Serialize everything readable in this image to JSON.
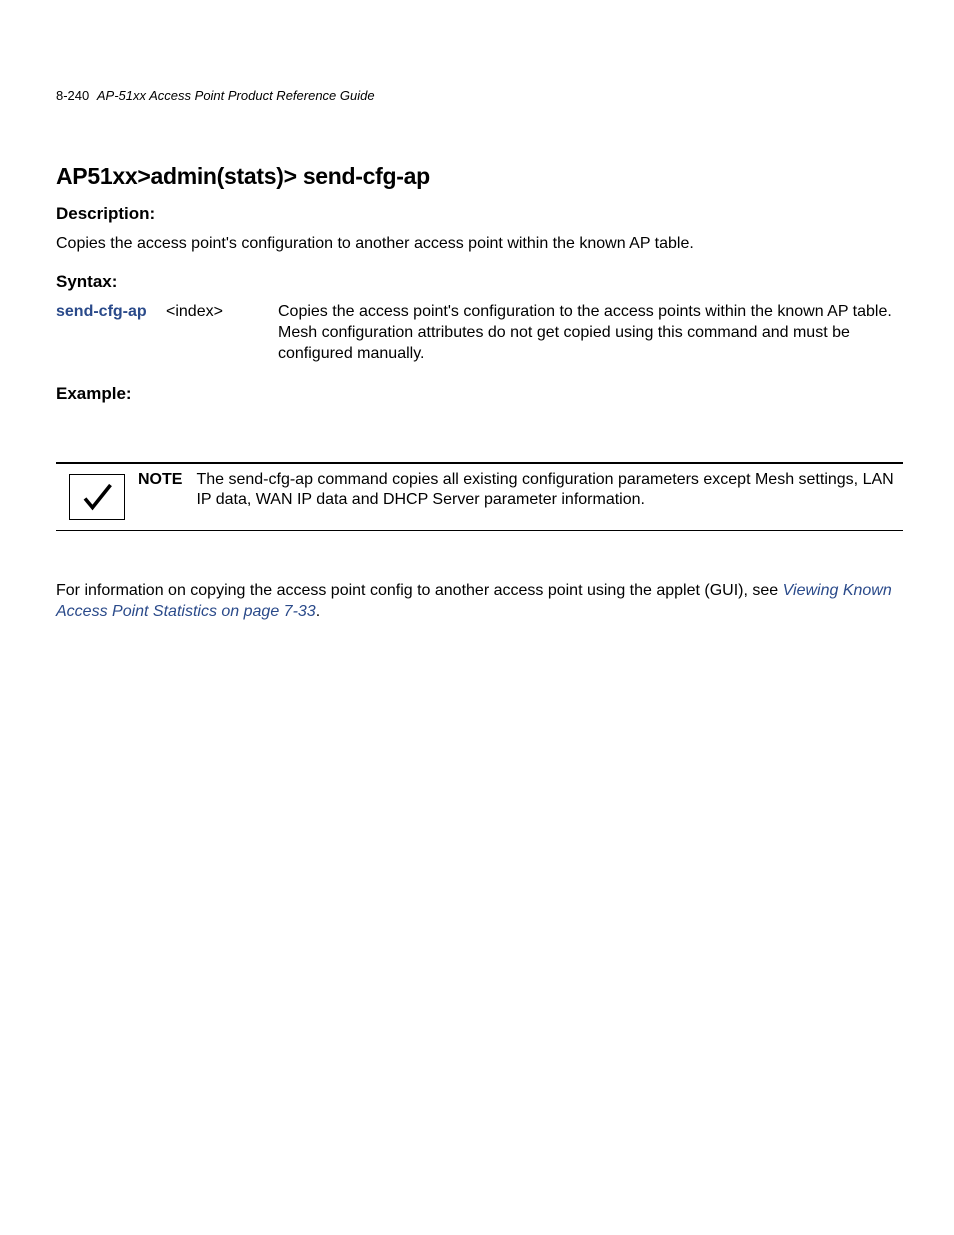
{
  "header": {
    "page_number": "8-240",
    "doc_title": "AP-51xx Access Point Product Reference Guide"
  },
  "title": "AP51xx>admin(stats)> send-cfg-ap",
  "sections": {
    "description": {
      "heading": "Description:",
      "body": "Copies the access point's configuration to another access point within the known AP table."
    },
    "syntax": {
      "heading": "Syntax:",
      "row": {
        "command": "send-cfg-ap",
        "arg": "<index>",
        "desc": "Copies the access point's configuration to the access points within the known AP table. Mesh configuration attributes do not get copied using this command and must be configured manually."
      }
    },
    "example": {
      "heading": "Example:"
    }
  },
  "note": {
    "label": "NOTE",
    "text": "The send-cfg-ap command copies all existing configuration parameters except Mesh settings, LAN IP data, WAN IP data and DHCP Server parameter information."
  },
  "crossref": {
    "prefix": "For information on copying the access point config to another access point using the applet (GUI), see ",
    "link": "Viewing Known Access Point Statistics on page 7-33",
    "suffix": "."
  }
}
